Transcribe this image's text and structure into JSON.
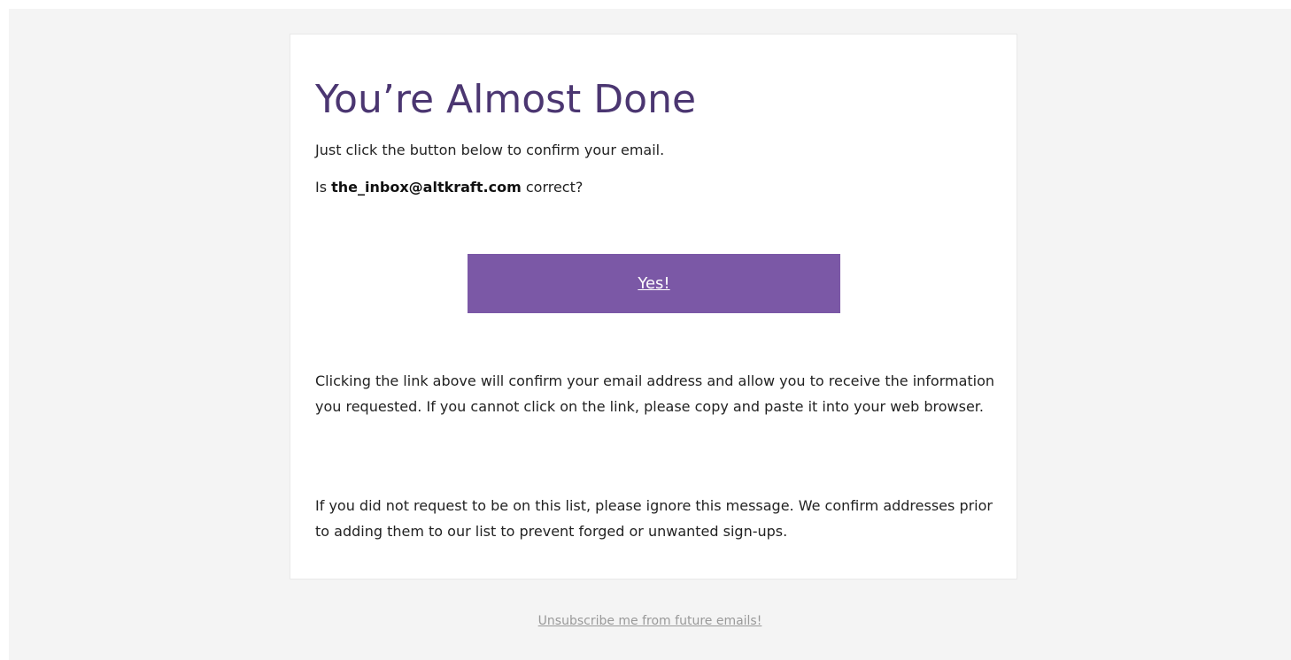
{
  "email": {
    "heading": "You’re Almost Done",
    "intro": "Just click the button below to confirm your email.",
    "question_prefix": "Is ",
    "address": "the_inbox@altkraft.com",
    "question_suffix": " correct?",
    "confirm_button_label": "Yes!",
    "explanation": "Clicking the link above will confirm your email address and allow you to receive the information you requested. If you cannot click on the link, please copy and paste it into your web browser.",
    "disclaimer": "If you did not request to be on this list, please ignore this message. We confirm addresses prior to adding them to our list to prevent forged or unwanted sign-ups."
  },
  "footer": {
    "unsubscribe_label": "Unsubscribe me from future emails!"
  },
  "colors": {
    "page_background": "#f4f4f4",
    "card_background": "#ffffff",
    "heading": "#4b3671",
    "button_background": "#7b58a6",
    "button_text": "#ffffff",
    "body_text": "#222222",
    "footer_link": "#999999"
  }
}
